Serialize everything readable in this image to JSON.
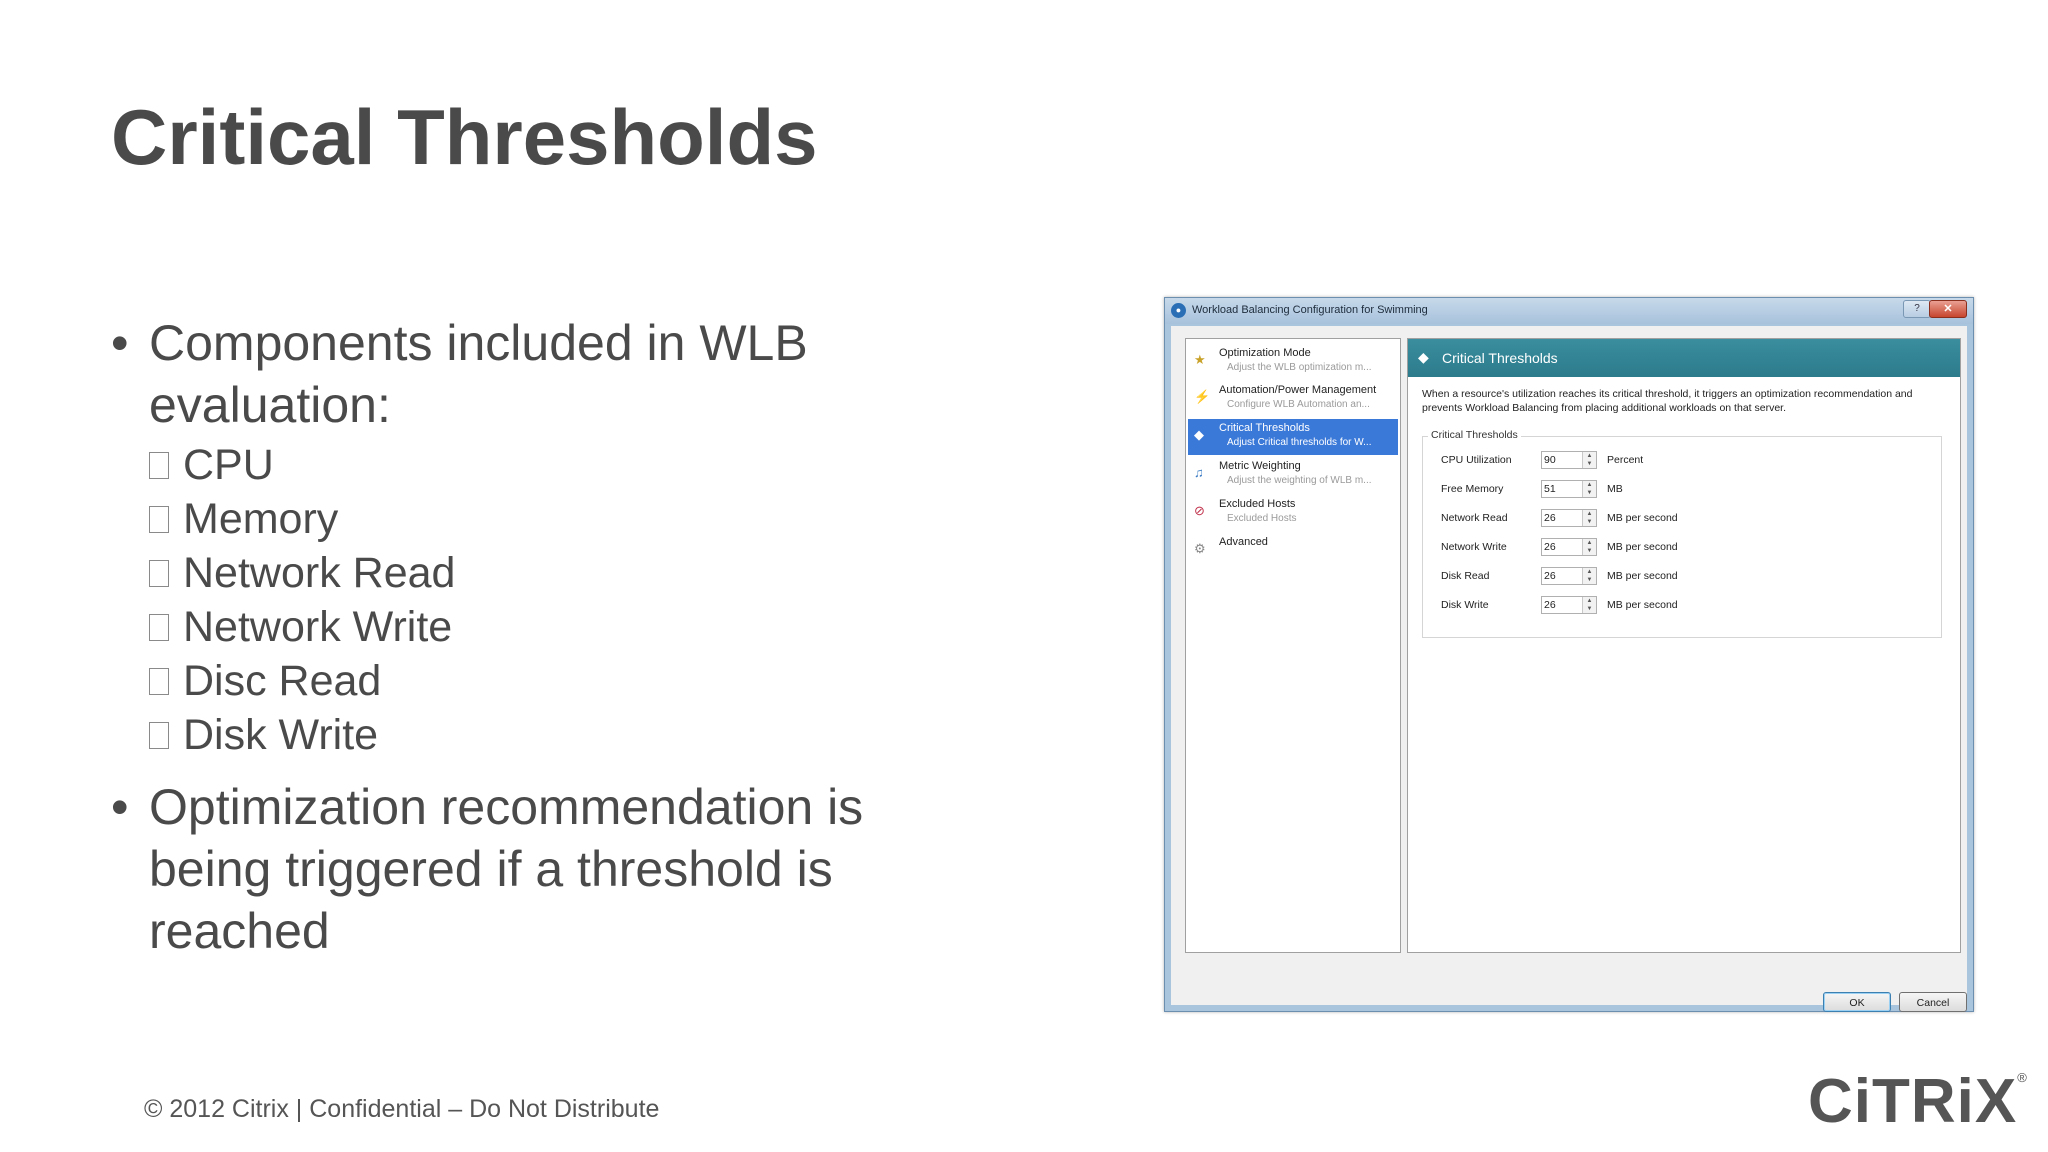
{
  "slide": {
    "title": "Critical Thresholds",
    "bullets": [
      {
        "text": "Components included in WLB evaluation:",
        "sub": [
          "CPU",
          "Memory",
          "Network Read",
          "Network Write",
          "Disc Read",
          "Disk Write"
        ]
      },
      {
        "text": "Optimization recommendation is being triggered if a threshold is reached"
      }
    ],
    "footer": "© 2012 Citrix | Confidential – Do Not Distribute",
    "logo": "CiTRiX",
    "logo_mark": "®"
  },
  "window": {
    "title": "Workload Balancing Configuration for Swimming",
    "help_label": "?",
    "close_label": "✕",
    "nav": [
      {
        "label": "Optimization Mode",
        "desc": "Adjust the WLB optimization m...",
        "icon": "star-icon",
        "glyph": "★",
        "selected": false
      },
      {
        "label": "Automation/Power Management",
        "desc": "Configure WLB Automation an...",
        "icon": "automation-icon",
        "glyph": "⚡",
        "selected": false
      },
      {
        "label": "Critical Thresholds",
        "desc": "Adjust Critical thresholds for W...",
        "icon": "threshold-icon",
        "glyph": "◆",
        "selected": true
      },
      {
        "label": "Metric Weighting",
        "desc": "Adjust the weighting of WLB m...",
        "icon": "weighting-icon",
        "glyph": "♫",
        "selected": false
      },
      {
        "label": "Excluded Hosts",
        "desc": "Excluded Hosts",
        "icon": "excluded-hosts-icon",
        "glyph": "⊘",
        "selected": false
      },
      {
        "label": "Advanced",
        "desc": "",
        "icon": "advanced-icon",
        "glyph": "⚙",
        "selected": false
      }
    ],
    "banner_title": "Critical Thresholds",
    "description": "When a resource's utilization reaches its critical threshold, it triggers an optimization recommendation and prevents Workload Balancing from placing additional workloads on that server.",
    "group_title": "Critical Thresholds",
    "thresholds": [
      {
        "label": "CPU Utilization",
        "value": "90",
        "unit": "Percent"
      },
      {
        "label": "Free Memory",
        "value": "51",
        "unit": "MB"
      },
      {
        "label": "Network Read",
        "value": "26",
        "unit": "MB per second"
      },
      {
        "label": "Network Write",
        "value": "26",
        "unit": "MB per second"
      },
      {
        "label": "Disk Read",
        "value": "26",
        "unit": "MB per second"
      },
      {
        "label": "Disk Write",
        "value": "26",
        "unit": "MB per second"
      }
    ],
    "ok_label": "OK",
    "cancel_label": "Cancel"
  }
}
